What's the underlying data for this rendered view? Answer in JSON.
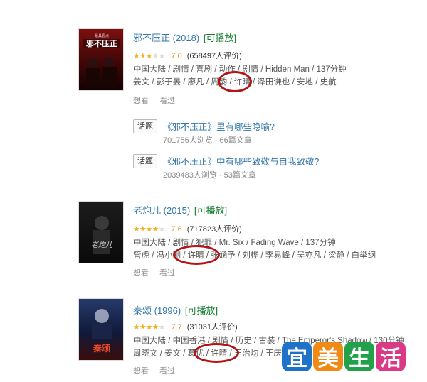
{
  "colors": {
    "link": "#3377aa",
    "playable": "#117a2b",
    "star": "#f2b01e",
    "circle": "#b21515"
  },
  "movies": [
    {
      "title": "邪不压正 (2018)",
      "playable": "[可播放]",
      "stars": 3.5,
      "score": "7.0",
      "votes": "(658497人评价)",
      "meta1": "中国大陆 / 剧情 / 喜剧 / 动作 / 剧情 / Hidden Man / 137分钟",
      "meta2": "姜文 / 彭于晏 / 廖凡 / 周韵 / 许晴 / 泽田谦也 / 安地 / 史航",
      "want": "想看",
      "seen": "看过",
      "poster_caption": "邪不压正"
    },
    {
      "title": "老炮儿 (2015)",
      "playable": "[可播放]",
      "stars": 4,
      "score": "7.6",
      "votes": "(717823人评价)",
      "meta1": "中国大陆 / 剧情 / 犯罪 / Mr. Six / Fading Wave / 137分钟",
      "meta2": "管虎 / 冯小刚 / 许晴 / 张涵予 / 刘桦 / 李易峰 / 吴亦凡 / 梁静 / 白举纲",
      "want": "想看",
      "seen": "看过",
      "poster_caption": "老炮儿"
    },
    {
      "title": "秦颂 (1996)",
      "playable": "[可播放]",
      "stars": 4,
      "score": "7.7",
      "votes": "(31031人评价)",
      "meta1": "中国大陆 / 中国香港 / 剧情 / 历史 / 古装 / The Emperor's Shadow / 130分钟",
      "meta2": "周晓文 / 姜文 / 葛优 / 许晴 / 王治均 / 王庆",
      "want": "想看",
      "seen": "看过",
      "poster_caption": "秦颂"
    }
  ],
  "topics": [
    {
      "badge": "话题",
      "title": "《邪不压正》里有哪些隐喻?",
      "stats": "701756人浏览 · 66篇文章"
    },
    {
      "badge": "话题",
      "title": "《邪不压正》中有哪些致敬与自我致敬?",
      "stats": "2039483人浏览 · 53篇文章"
    }
  ],
  "watermark": [
    "宜",
    "美",
    "生",
    "活"
  ],
  "watermark_colors": [
    "#1e73c8",
    "#f08a14",
    "#21a24a",
    "#d83a86"
  ]
}
